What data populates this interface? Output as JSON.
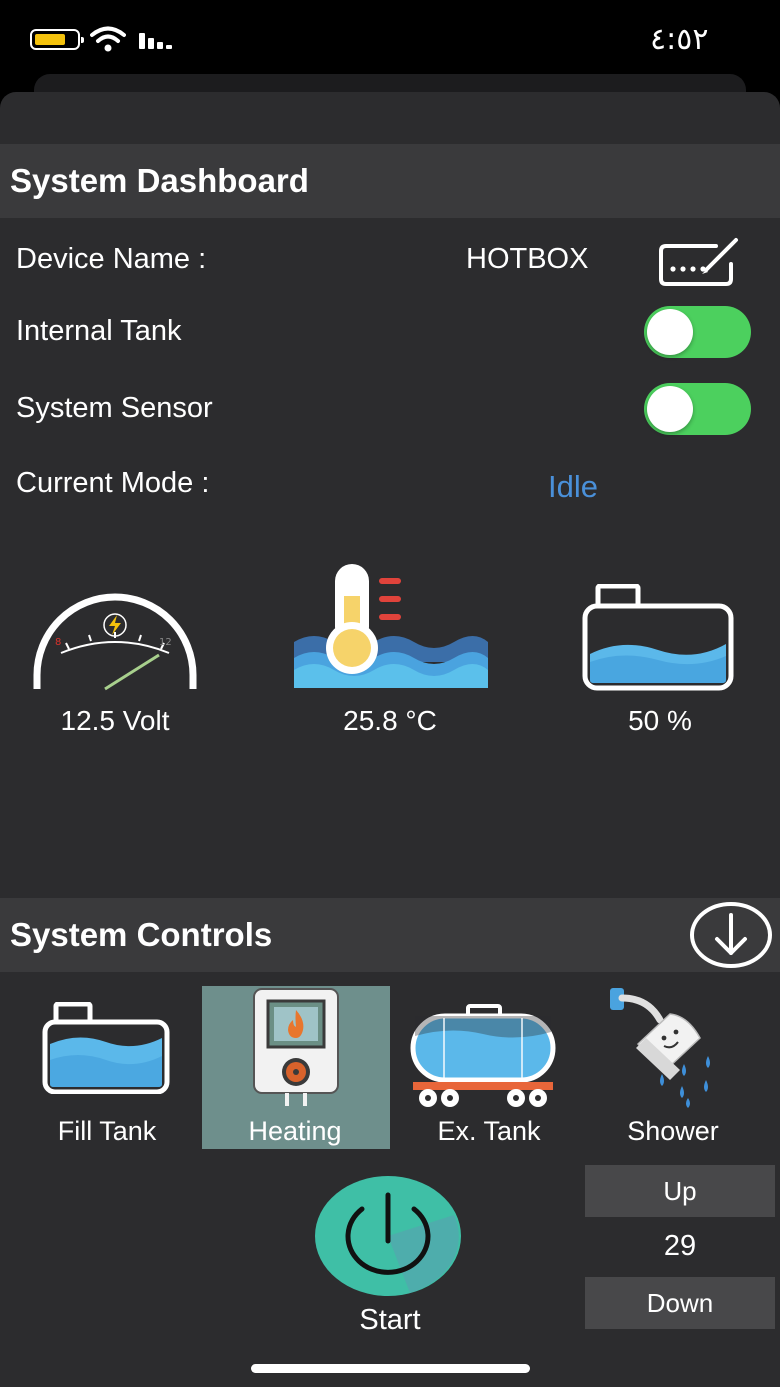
{
  "status_bar": {
    "time": "٤:٥٢",
    "battery_level": 0.65
  },
  "dashboard": {
    "title": "System Dashboard",
    "device_name_label": "Device Name :",
    "device_name_value": "HOTBOX",
    "internal_tank_label": "Internal Tank",
    "internal_tank_on": true,
    "system_sensor_label": "System Sensor",
    "system_sensor_on": true,
    "current_mode_label": "Current Mode :",
    "current_mode_value": "Idle",
    "voltage": "12.5 Volt",
    "voltage_gauge_min_tick": "8",
    "voltage_gauge_max_tick": "12",
    "temperature": "25.8 °C",
    "tank_level": "50 %"
  },
  "controls": {
    "title": "System Controls",
    "items": [
      {
        "label": "Fill Tank",
        "icon": "fill-tank-icon"
      },
      {
        "label": "Heating",
        "icon": "heater-icon",
        "selected": true
      },
      {
        "label": "Ex. Tank",
        "icon": "tanker-icon"
      },
      {
        "label": "Shower",
        "icon": "shower-icon"
      }
    ],
    "up_label": "Up",
    "counter_value": "29",
    "down_label": "Down",
    "start_label": "Start"
  },
  "colors": {
    "accent_blue": "#4a90d9",
    "toggle_green": "#4cd05e",
    "selected_tile": "#6e8f8c",
    "start_button": "#3fbfa6",
    "header_bg": "#3a3a3c",
    "sheet_bg": "#2c2c2e"
  }
}
